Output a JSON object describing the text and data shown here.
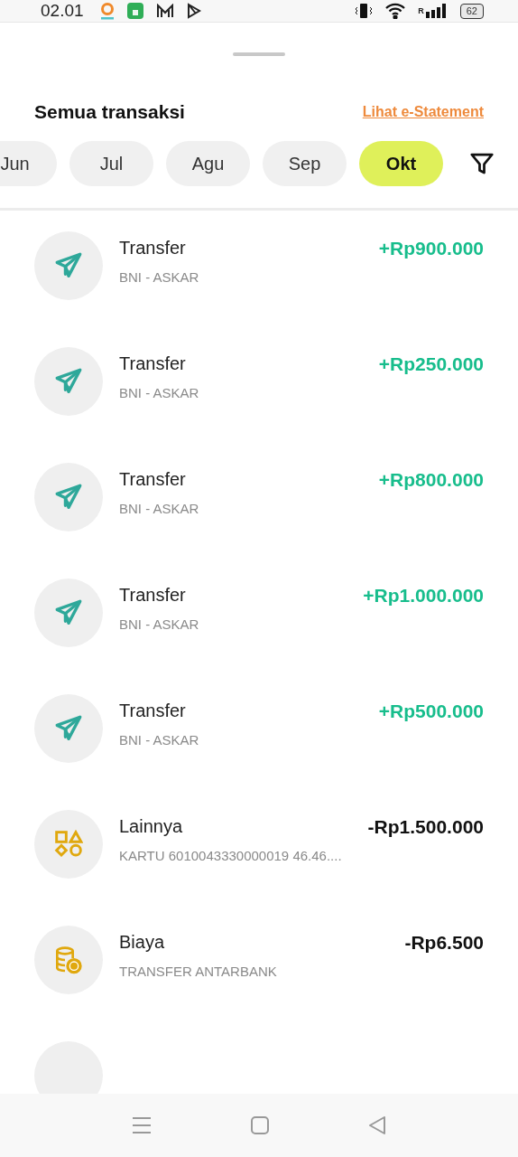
{
  "status_bar": {
    "time": "02.01",
    "battery": "62",
    "network": "R"
  },
  "header": {
    "title": "Semua transaksi",
    "link": "Lihat e-Statement"
  },
  "months": [
    {
      "label": "Jun",
      "selected": false
    },
    {
      "label": "Jul",
      "selected": false
    },
    {
      "label": "Agu",
      "selected": false
    },
    {
      "label": "Sep",
      "selected": false
    },
    {
      "label": "Okt",
      "selected": true
    }
  ],
  "transactions": [
    {
      "kind": "transfer",
      "title": "Transfer",
      "subtitle": "BNI - ASKAR",
      "amount": "+Rp900.000",
      "credit": true
    },
    {
      "kind": "transfer",
      "title": "Transfer",
      "subtitle": "BNI - ASKAR",
      "amount": "+Rp250.000",
      "credit": true
    },
    {
      "kind": "transfer",
      "title": "Transfer",
      "subtitle": "BNI - ASKAR",
      "amount": "+Rp800.000",
      "credit": true
    },
    {
      "kind": "transfer",
      "title": "Transfer",
      "subtitle": "BNI - ASKAR",
      "amount": "+Rp1.000.000",
      "credit": true
    },
    {
      "kind": "transfer",
      "title": "Transfer",
      "subtitle": "BNI - ASKAR",
      "amount": "+Rp500.000",
      "credit": true
    },
    {
      "kind": "other",
      "title": "Lainnya",
      "subtitle": "KARTU 6010043330000019 46.46....",
      "amount": "-Rp1.500.000",
      "credit": false
    },
    {
      "kind": "fee",
      "title": "Biaya",
      "subtitle": "TRANSFER ANTARBANK",
      "amount": "-Rp6.500",
      "credit": false
    }
  ]
}
